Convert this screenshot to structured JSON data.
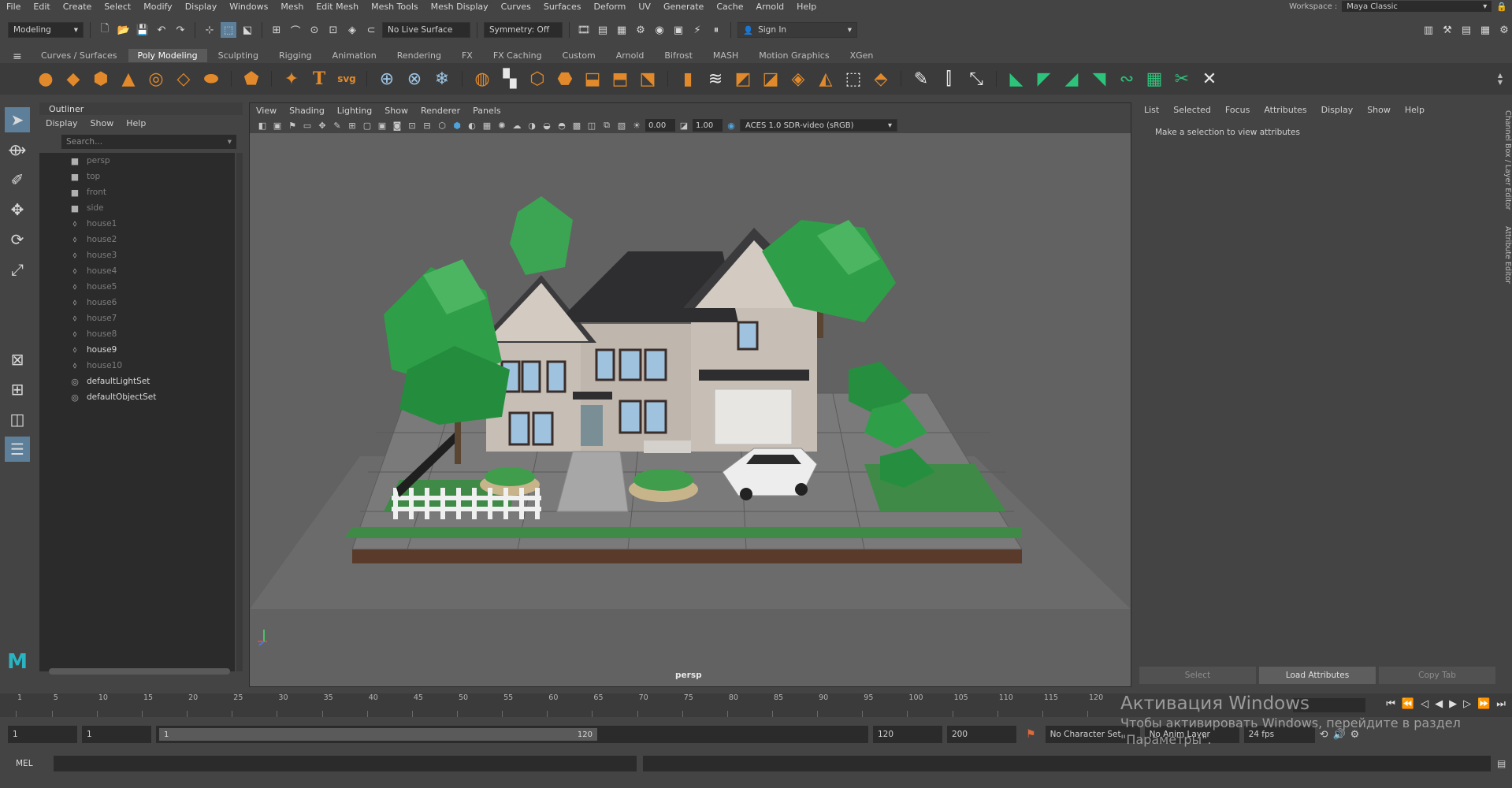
{
  "menubar": {
    "items": [
      "File",
      "Edit",
      "Create",
      "Select",
      "Modify",
      "Display",
      "Windows",
      "Mesh",
      "Edit Mesh",
      "Mesh Tools",
      "Mesh Display",
      "Curves",
      "Surfaces",
      "Deform",
      "UV",
      "Generate",
      "Cache",
      "Arnold",
      "Help"
    ],
    "workspace_label": "Workspace :",
    "workspace_value": "Maya Classic"
  },
  "statusline": {
    "mode": "Modeling",
    "live_surface": "No Live Surface",
    "symmetry": "Symmetry: Off",
    "sign_in": "Sign In"
  },
  "shelf": {
    "tabs": [
      "Curves / Surfaces",
      "Poly Modeling",
      "Sculpting",
      "Rigging",
      "Animation",
      "Rendering",
      "FX",
      "FX Caching",
      "Custom",
      "Arnold",
      "Bifrost",
      "MASH",
      "Motion Graphics",
      "XGen"
    ],
    "active_tab": "Poly Modeling"
  },
  "outliner": {
    "title": "Outliner",
    "menu": [
      "Display",
      "Show",
      "Help"
    ],
    "search_placeholder": "Search...",
    "items": [
      {
        "name": "persp",
        "icon": "camera-icon",
        "bright": false
      },
      {
        "name": "top",
        "icon": "camera-icon",
        "bright": false
      },
      {
        "name": "front",
        "icon": "camera-icon",
        "bright": false
      },
      {
        "name": "side",
        "icon": "camera-icon",
        "bright": false
      },
      {
        "name": "house1",
        "icon": "transform-icon",
        "bright": false
      },
      {
        "name": "house2",
        "icon": "transform-icon",
        "bright": false
      },
      {
        "name": "house3",
        "icon": "transform-icon",
        "bright": false
      },
      {
        "name": "house4",
        "icon": "transform-icon",
        "bright": false
      },
      {
        "name": "house5",
        "icon": "transform-icon",
        "bright": false
      },
      {
        "name": "house6",
        "icon": "transform-icon",
        "bright": false
      },
      {
        "name": "house7",
        "icon": "transform-icon",
        "bright": false
      },
      {
        "name": "house8",
        "icon": "transform-icon",
        "bright": false
      },
      {
        "name": "house9",
        "icon": "transform-icon",
        "bright": true
      },
      {
        "name": "house10",
        "icon": "transform-icon",
        "bright": false
      },
      {
        "name": "defaultLightSet",
        "icon": "set-icon",
        "bright": true
      },
      {
        "name": "defaultObjectSet",
        "icon": "set-icon",
        "bright": true
      }
    ]
  },
  "viewport": {
    "menu": [
      "View",
      "Shading",
      "Lighting",
      "Show",
      "Renderer",
      "Panels"
    ],
    "exposure": "0.00",
    "gamma": "1.00",
    "color_space": "ACES 1.0 SDR-video (sRGB)",
    "camera_label": "persp"
  },
  "attribute_editor": {
    "menu": [
      "List",
      "Selected",
      "Focus",
      "Attributes",
      "Display",
      "Show",
      "Help"
    ],
    "message": "Make a selection to view attributes",
    "buttons": [
      "Select",
      "Load Attributes",
      "Copy Tab"
    ]
  },
  "side_tabs": [
    "Channel Box / Layer Editor",
    "Attribute Editor"
  ],
  "timeline": {
    "ticks": [
      "1",
      "5",
      "10",
      "15",
      "20",
      "25",
      "30",
      "35",
      "40",
      "45",
      "50",
      "55",
      "60",
      "65",
      "70",
      "75",
      "80",
      "85",
      "90",
      "95",
      "100",
      "105",
      "110",
      "115",
      "120"
    ]
  },
  "range": {
    "start": "1",
    "playback_start": "1",
    "slider_start": "1",
    "slider_end": "120",
    "playback_end": "120",
    "end": "200",
    "character_set": "No Character Set",
    "anim_layer": "No Anim Layer",
    "fps": "24 fps"
  },
  "command": {
    "label": "MEL"
  },
  "activation": {
    "line1": "Активация Windows",
    "line2": "Чтобы активировать Windows, перейдите в раздел",
    "line3": "\"Параметры\"."
  }
}
